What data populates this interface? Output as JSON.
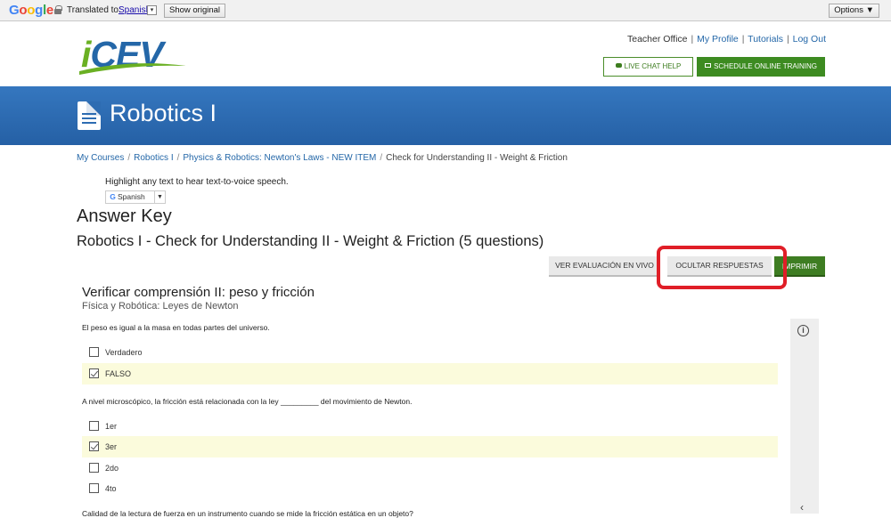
{
  "translate_bar": {
    "brand": [
      "G",
      "o",
      "o",
      "g",
      "l",
      "e"
    ],
    "translated_to": "Translated to:",
    "language": "Spanish",
    "language_arrow": "▾",
    "show_original": "Show original",
    "options": "Options ▼"
  },
  "header": {
    "logo_i": "i",
    "logo_rest": "CEV",
    "links": [
      "Teacher Office",
      "My Profile",
      "Tutorials",
      "Log Out"
    ],
    "separator": "|",
    "live_chat": "LIVE CHAT HELP",
    "schedule": "SCHEDULE ONLINE TRAINING"
  },
  "banner": {
    "title": "Robotics I"
  },
  "breadcrumb": {
    "items": [
      "My Courses",
      "Robotics I",
      "Physics & Robotics: Newton's Laws - NEW ITEM",
      "Check for Understanding II - Weight & Friction"
    ],
    "separator": "/"
  },
  "tts": {
    "text": "Highlight any text to hear text-to-voice speech.",
    "widget_g": "G",
    "widget_lang": "Spanish",
    "widget_arrow": "▼"
  },
  "page": {
    "answer_key": "Answer Key",
    "quiz_title": "Robotics I - Check for Understanding II - Weight & Friction (5 questions)"
  },
  "actions": {
    "live": "VER EVALUACIÓN EN VIVO",
    "hide": "OCULTAR RESPUESTAS",
    "print": "IMPRIMIR"
  },
  "quiz": {
    "heading": "Verificar comprensión II: peso y fricción",
    "subheading": "Física y Robótica: Leyes de Newton",
    "q1": {
      "text": "El peso es igual a la masa en todas partes del universo.",
      "options": [
        {
          "label": "Verdadero",
          "correct": false
        },
        {
          "label": "FALSO",
          "correct": true
        }
      ]
    },
    "q2": {
      "text": "A nivel microscópico, la fricción está relacionada con la ley _________ del movimiento de Newton.",
      "options": [
        {
          "label": "1er",
          "correct": false
        },
        {
          "label": "3er",
          "correct": true
        },
        {
          "label": "2do",
          "correct": false
        },
        {
          "label": "4to",
          "correct": false
        }
      ]
    },
    "q3_partial": "Calidad de la lectura de fuerza en un instrumento cuando se mide la fricción estática en un objeto?"
  },
  "side": {
    "accessibility": "i",
    "chevron": "‹"
  }
}
